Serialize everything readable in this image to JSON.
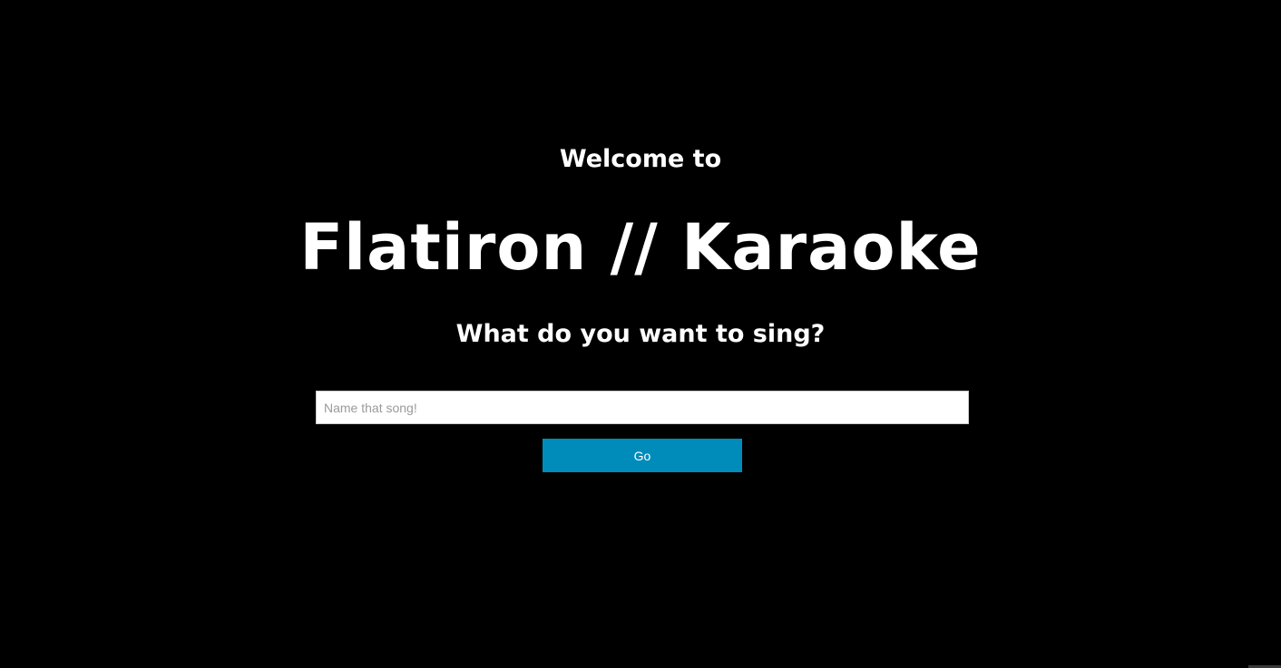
{
  "header": {
    "welcome": "Welcome to",
    "title": "Flatiron // Karaoke",
    "subtitle": "What do you want to sing?"
  },
  "search": {
    "value": "",
    "placeholder": "Name that song!"
  },
  "actions": {
    "go_label": "Go"
  },
  "colors": {
    "background": "#000000",
    "text": "#ffffff",
    "button": "#008cba"
  }
}
